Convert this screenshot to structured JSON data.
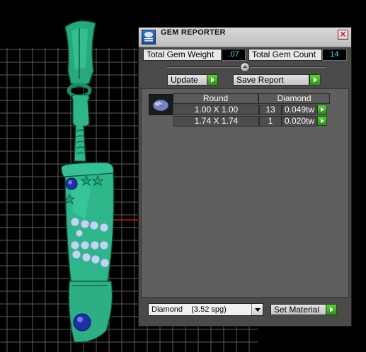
{
  "panel": {
    "title": "GEM REPORTER",
    "close_symbol": "×",
    "total_weight_label": "Total Gem Weight",
    "total_weight_value": ".07",
    "total_count_label": "Total Gem Count",
    "total_count_value": "14",
    "update_label": "Update",
    "save_report_label": "Save Report",
    "table": {
      "shape_header": "Round",
      "material_header": "Diamond",
      "rows": [
        {
          "size": "1.00 X 1.00",
          "count": "13",
          "weight": "0.049tw"
        },
        {
          "size": "1.74 X 1.74",
          "count": "1",
          "weight": "0.020tw"
        }
      ]
    },
    "material_select_value": "Diamond    (3.52 spg)",
    "set_material_label": "Set Material"
  },
  "icons": {
    "app": "gem-report-icon",
    "close": "close-icon",
    "collapse": "collapse-knob-icon",
    "arrow": "green-arrow-icon",
    "gem": "gem-thumbnail-icon",
    "dropdown": "chevron-down-icon"
  },
  "colors": {
    "panel_bg": "#4a4a4a",
    "title_bg": "#cfcfcf",
    "value_text": "#5fd4ff",
    "accent_green": "#3fae22",
    "model_green": "#2fb58a",
    "gem_blue": "#1f2fa6",
    "grid_line": "#8a8a8a"
  }
}
